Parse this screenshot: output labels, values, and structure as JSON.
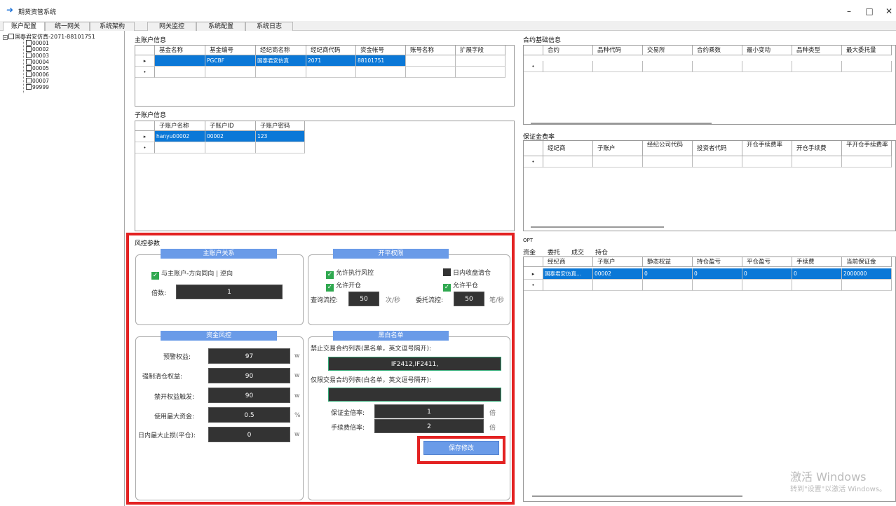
{
  "app": {
    "title": "期货资管系统",
    "icon": "arrow-right-icon",
    "win_controls": [
      "–",
      "□",
      "✕"
    ]
  },
  "tabs": [
    "账户配置",
    "统一网关",
    "系统架构",
    "网关监控",
    "系统配置",
    "系统日志"
  ],
  "tree": {
    "root": "国泰君安仿真-2071-88101751",
    "items": [
      "00001",
      "00002",
      "00003",
      "00004",
      "00005",
      "00006",
      "00007",
      "99999"
    ]
  },
  "main_account": {
    "title": "主账户信息",
    "columns": [
      "基金名称",
      "基金编号",
      "经纪商名称",
      "经纪商代码",
      "资金帐号",
      "账号名称",
      "扩展字段"
    ],
    "row": [
      "",
      "PGCBF",
      "国泰君安仿真",
      "2071",
      "88101751",
      "",
      ""
    ]
  },
  "sub_account": {
    "title": "子账户信息",
    "columns": [
      "子账户名称",
      "子账户ID",
      "子账户密码"
    ],
    "row": [
      "hanyu00002",
      "00002",
      "123"
    ]
  },
  "contract": {
    "title": "合约基础信息",
    "columns": [
      "合约",
      "品种代码",
      "交易所",
      "合约乘数",
      "最小变动",
      "品种类型",
      "最大委托量"
    ]
  },
  "margin": {
    "title": "保证金费率",
    "columns": [
      "经纪商",
      "子账户",
      "经纪公司代码",
      "投资者代码",
      "开仓手续费率",
      "开仓手续费",
      "平开仓手续费率"
    ]
  },
  "opt": {
    "title": "OPT",
    "tabs": [
      "资金",
      "委托",
      "成交",
      "持仓"
    ],
    "columns": [
      "经纪商",
      "子账户",
      "静态权益",
      "持仓盈亏",
      "平仓盈亏",
      "手续费",
      "当前保证金"
    ],
    "row": [
      "国泰君安仿真...",
      "00002",
      "0",
      "0",
      "0",
      "0",
      "2000000"
    ]
  },
  "risk": {
    "title": "风控参数",
    "main_rel": {
      "title": "主账户关系",
      "check_label": "与主账户-方向同向 | 逆向",
      "multiplier_label": "倍数:",
      "multiplier": "1"
    },
    "open_close": {
      "title": "开平权限",
      "allow_risk": "允许执行风控",
      "intraday_close": "日内收盘清仓",
      "allow_open": "允许开仓",
      "allow_close": "允许平仓",
      "query_label": "查询流控:",
      "query_value": "50",
      "query_unit": "次/秒",
      "order_label": "委托流控:",
      "order_value": "50",
      "order_unit": "笔/秒"
    },
    "fund": {
      "title": "资金风控",
      "rows": [
        {
          "label": "预警权益:",
          "value": "97",
          "unit": "w"
        },
        {
          "label": "强制清仓权益:",
          "value": "90",
          "unit": "w"
        },
        {
          "label": "禁开权益触发:",
          "value": "90",
          "unit": "w"
        },
        {
          "label": "使用最大资金:",
          "value": "0.5",
          "unit": "%"
        },
        {
          "label": "日内最大止损(平仓):",
          "value": "0",
          "unit": "w"
        }
      ]
    },
    "bw": {
      "title": "黑白名单",
      "black_label": "禁止交易合约列表(黑名单，英文逗号隔开):",
      "black_value": "IF2412,IF2411,",
      "white_label": "仅限交易合约列表(白名单，英文逗号隔开):",
      "white_value": "",
      "margin_label": "保证金倍率:",
      "margin_value": "1",
      "margin_unit": "倍",
      "fee_label": "手续费倍率:",
      "fee_value": "2",
      "fee_unit": "倍",
      "save": "保存修改"
    }
  },
  "watermark": {
    "line1": "激活 Windows",
    "line2": "转到\"设置\"以激活 Windows。"
  },
  "colors": {
    "selection": "#0b78d7",
    "panel_title": "#6a9be8",
    "highlight": "#e32222",
    "check": "#2fa84f"
  }
}
